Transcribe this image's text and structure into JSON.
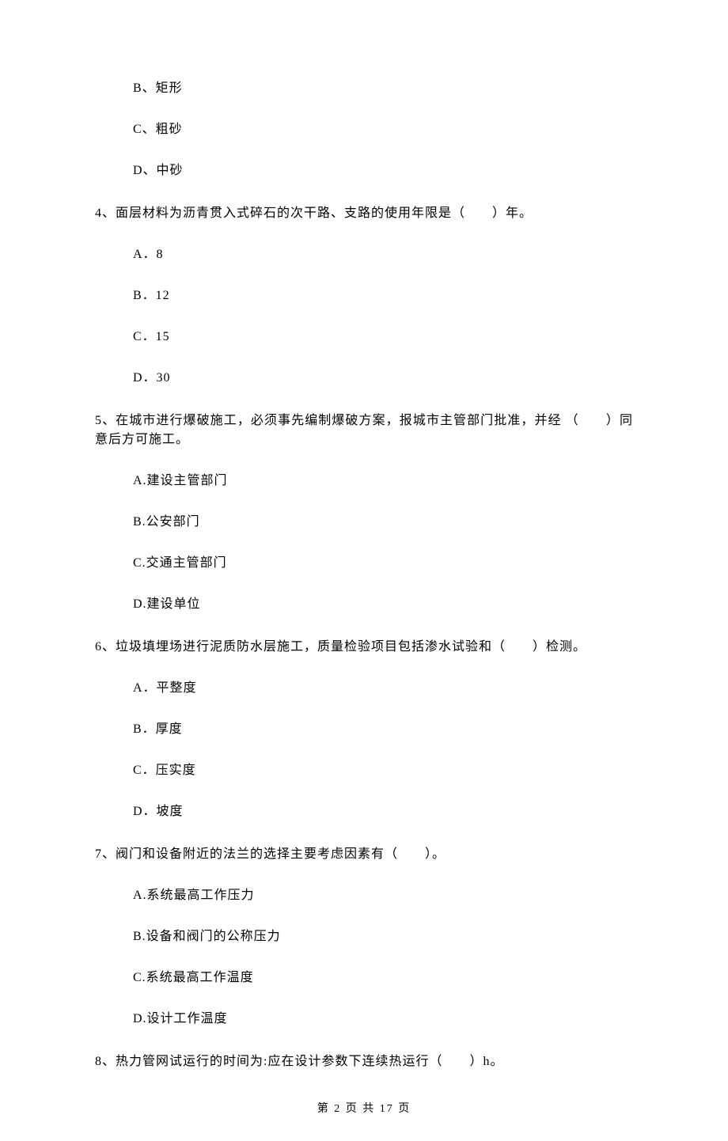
{
  "prev_options": [
    "B、矩形",
    "C、粗砂",
    "D、中砂"
  ],
  "questions": [
    {
      "text": "4、面层材料为沥青贯入式碎石的次干路、支路的使用年限是（　　）年。",
      "options": [
        "A．8",
        "B．12",
        "C．15",
        "D．30"
      ]
    },
    {
      "text": "5、在城市进行爆破施工，必须事先编制爆破方案，报城市主管部门批准，并经 （　　）同意后方可施工。",
      "options": [
        "A.建设主管部门",
        "B.公安部门",
        "C.交通主管部门",
        "D.建设单位"
      ]
    },
    {
      "text": "6、垃圾填埋场进行泥质防水层施工，质量检验项目包括渗水试验和（　　）检测。",
      "options": [
        "A．平整度",
        "B．厚度",
        "C．压实度",
        "D．坡度"
      ]
    },
    {
      "text": "7、阀门和设备附近的法兰的选择主要考虑因素有（　　）。",
      "options": [
        "A.系统最高工作压力",
        "B.设备和阀门的公称压力",
        "C.系统最高工作温度",
        "D.设计工作温度"
      ]
    },
    {
      "text": "8、热力管网试运行的时间为:应在设计参数下连续热运行（　　）h。",
      "options": []
    }
  ],
  "footer": "第 2 页 共 17 页"
}
